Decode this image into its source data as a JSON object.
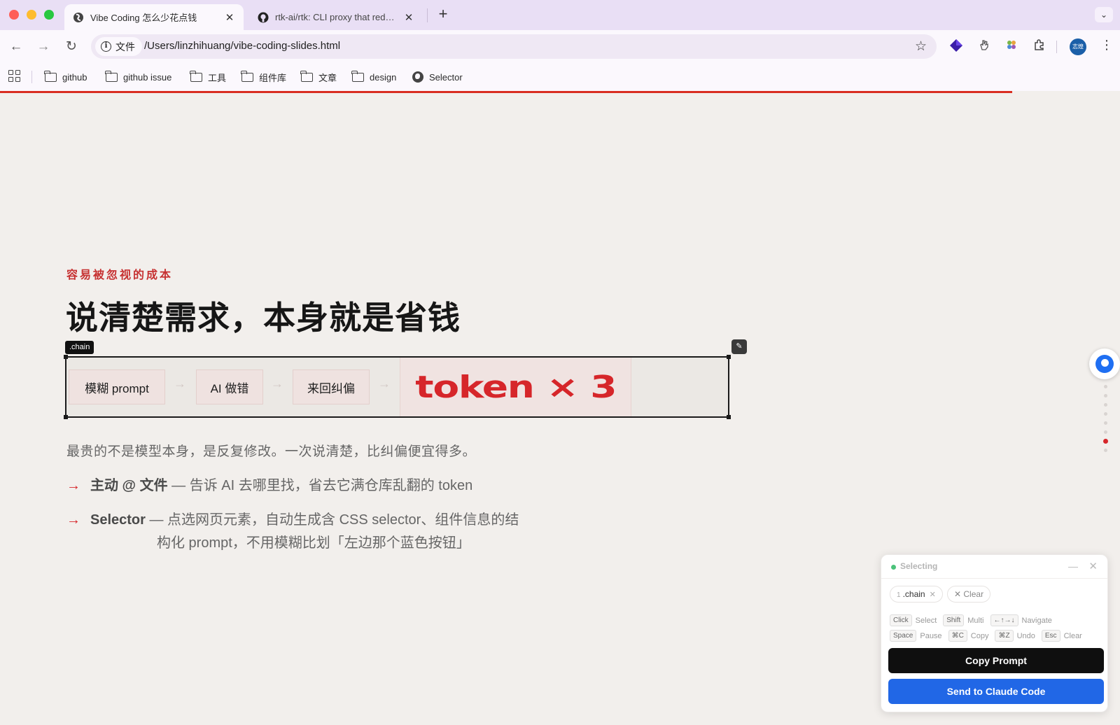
{
  "browser": {
    "tabs": [
      {
        "title": "Vibe Coding 怎么少花点钱",
        "active": true
      },
      {
        "title": "rtk-ai/rtk: CLI proxy that reduces",
        "active": false
      }
    ],
    "new_tab": "+",
    "tab_menu": "⌄",
    "site_chip": "文件",
    "url": "/Users/linzhihuang/vibe-coding-slides.html",
    "avatar_text": "志煌",
    "bookmarks": [
      "github",
      "github issue",
      "工具",
      "组件库",
      "文章",
      "design",
      "Selector"
    ],
    "colors": {
      "tabbar": "#e9dff5",
      "toolbar": "#fbf8fd",
      "progress": "#d92d20"
    }
  },
  "slide": {
    "eyebrow": "容易被忽视的成本",
    "headline": "说清楚需求，本身就是省钱",
    "chain_badge": ".chain",
    "steps": [
      "模糊 prompt",
      "AI 做错",
      "来回纠偏"
    ],
    "step_arrow": "→",
    "token_label": "token × 3",
    "subtitle": "最贵的不是模型本身，是反复修改。一次说清楚，比纠偏便宜得多。",
    "bullet_arrow": "→",
    "bullets": [
      {
        "strong": "主动 @ 文件",
        "text": " — 告诉 AI 去哪里找，省去它满仓库乱翻的 token",
        "cont": ""
      },
      {
        "strong": "Selector",
        "text": " — 点选网页元素，自动生成含 CSS selector、组件信息的结",
        "cont": "构化 prompt，不用模糊比划「左边那个蓝色按钮」"
      }
    ],
    "accent_color": "#d6262a"
  },
  "selector_panel": {
    "status": "Selecting",
    "selection_index": "1",
    "selection_name": ".chain",
    "clear_label": "Clear",
    "shortcuts": [
      [
        {
          "key": "Click",
          "label": "Select"
        },
        {
          "key": "Shift",
          "label": "Multi"
        },
        {
          "key": "←↑→↓",
          "label": "Navigate"
        }
      ],
      [
        {
          "key": "Space",
          "label": "Pause"
        },
        {
          "key": "⌘C",
          "label": "Copy"
        },
        {
          "key": "⌘Z",
          "label": "Undo"
        },
        {
          "key": "Esc",
          "label": "Clear"
        }
      ]
    ],
    "copy_button": "Copy Prompt",
    "send_button": "Send to Claude Code",
    "colors": {
      "copy": "#0f0f0f",
      "send": "#2167e6",
      "status": "#4bc27a"
    }
  }
}
